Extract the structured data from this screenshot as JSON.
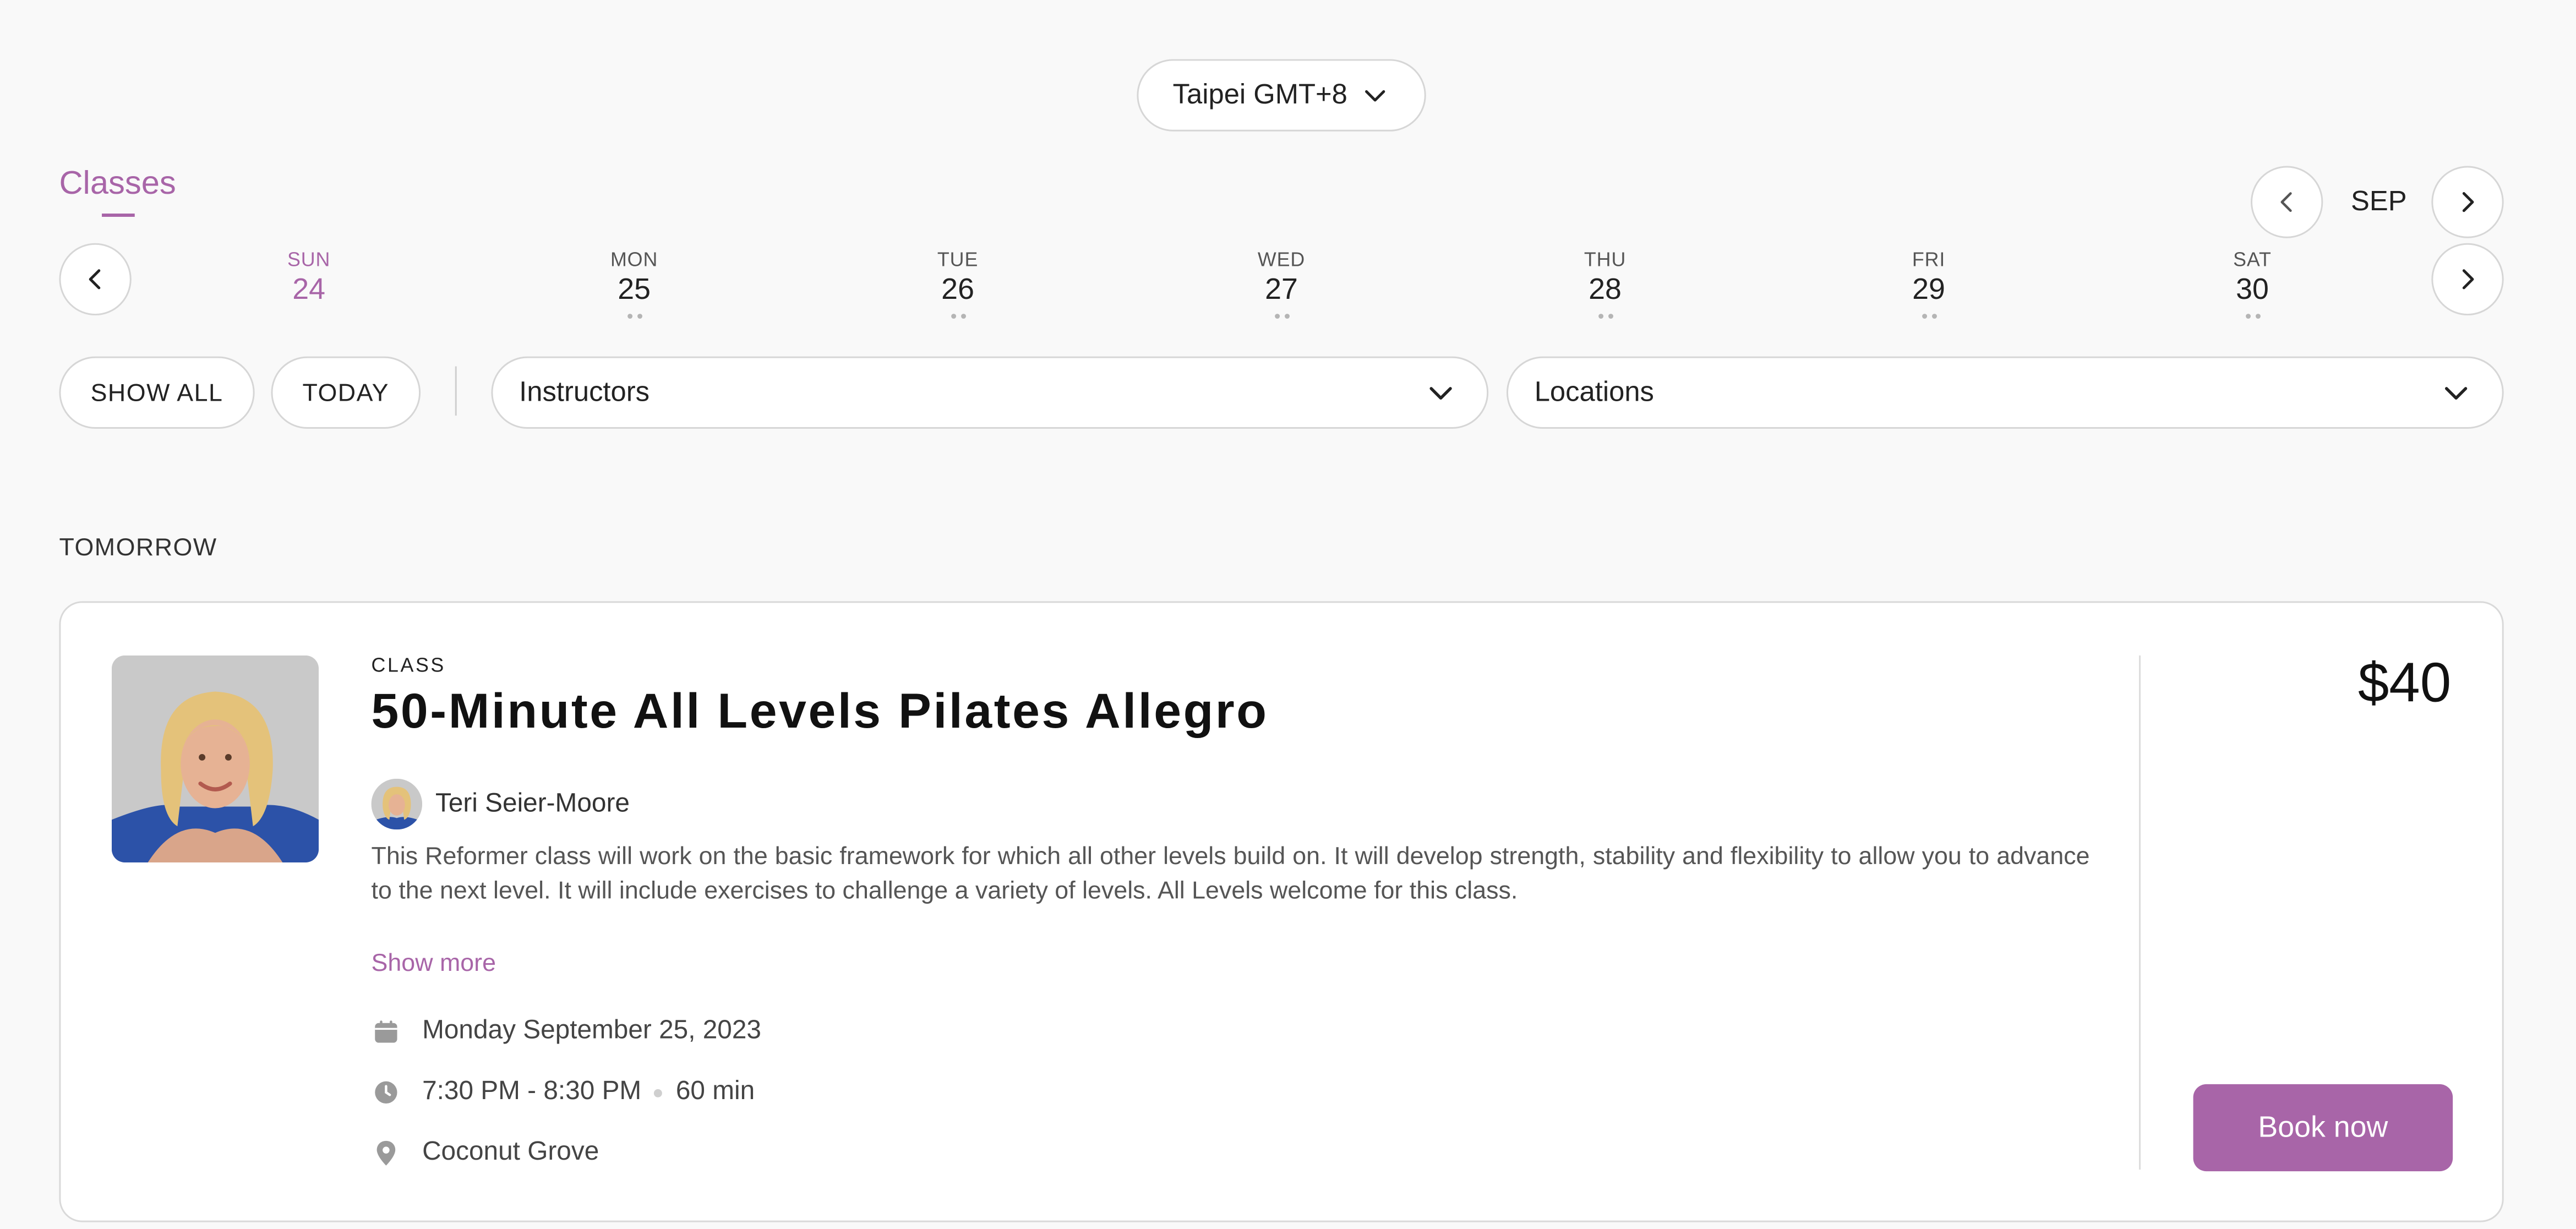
{
  "timezone": {
    "label": "Taipei GMT+8"
  },
  "tabs": {
    "classes_label": "Classes"
  },
  "calendar": {
    "month": "SEP",
    "days": [
      {
        "name": "SUN",
        "date": "24",
        "active": true
      },
      {
        "name": "MON",
        "date": "25",
        "active": false
      },
      {
        "name": "TUE",
        "date": "26",
        "active": false
      },
      {
        "name": "WED",
        "date": "27",
        "active": false
      },
      {
        "name": "THU",
        "date": "28",
        "active": false
      },
      {
        "name": "FRI",
        "date": "29",
        "active": false
      },
      {
        "name": "SAT",
        "date": "30",
        "active": false
      }
    ]
  },
  "filters": {
    "show_all": "SHOW ALL",
    "today": "TODAY",
    "instructors": "Instructors",
    "locations": "Locations"
  },
  "section": {
    "heading": "TOMORROW"
  },
  "class_card": {
    "tag": "CLASS",
    "title": "50-Minute All Levels Pilates Allegro",
    "instructor": "Teri Seier-Moore",
    "description": "This Reformer class will work on the basic framework for which all other levels build on. It will develop strength, stability and flexibility to allow you to advance to the next level. It will include exercises to challenge a variety of levels. All Levels welcome for this class.",
    "show_more": "Show more",
    "date": "Monday September 25, 2023",
    "time": "7:30 PM - 8:30 PM",
    "duration": "60 min",
    "location": "Coconut Grove",
    "price": "$40",
    "book_label": "Book now"
  },
  "colors": {
    "accent": "#a865a8",
    "background": "#f9f9f9",
    "card": "#ffffff",
    "border": "#d6d6d6",
    "text": "#222222"
  },
  "icons": {
    "timezone_toggle": "chevron-down-icon",
    "month_prev": "chevron-left-icon",
    "month_next": "chevron-right-icon",
    "week_prev": "chevron-left-icon",
    "week_next": "chevron-right-icon",
    "dropdown": "chevron-down-icon",
    "date": "calendar-icon",
    "time": "clock-icon",
    "location": "map-pin-icon"
  }
}
